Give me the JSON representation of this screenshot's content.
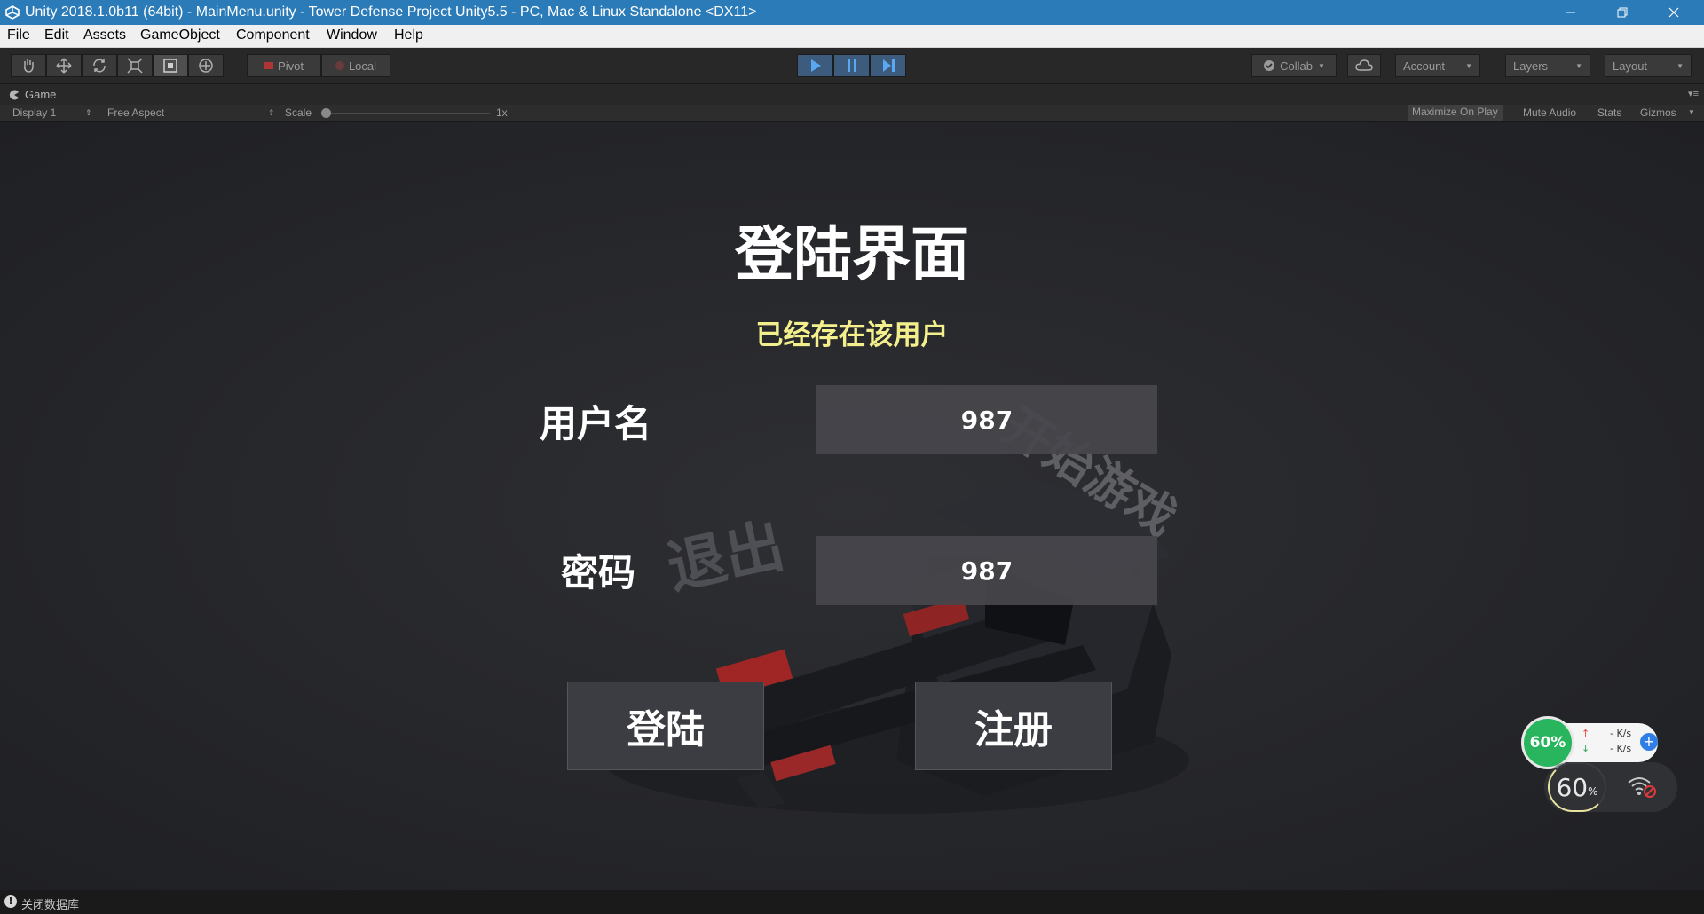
{
  "window": {
    "title": "Unity 2018.1.0b11 (64bit) - MainMenu.unity - Tower Defense Project Unity5.5 - PC, Mac & Linux Standalone <DX11>",
    "icons": [
      "unity-logo-icon",
      "minimize-icon",
      "restore-icon",
      "close-icon"
    ]
  },
  "menu": {
    "items": [
      "File",
      "Edit",
      "Assets",
      "GameObject",
      "Component",
      "Window",
      "Help"
    ]
  },
  "toolbar": {
    "tools": [
      "hand-tool-icon",
      "move-tool-icon",
      "rotate-tool-icon",
      "scale-tool-icon",
      "rect-tool-icon",
      "transform-tool-icon"
    ],
    "pivot_label": "Pivot",
    "local_label": "Local",
    "playback": [
      "play-icon",
      "pause-icon",
      "step-icon"
    ],
    "collab_label": "Collab",
    "account_label": "Account",
    "layers_label": "Layers",
    "layout_label": "Layout",
    "accent": "#3d5c7d"
  },
  "game_view": {
    "tab_label": "Game",
    "display": "Display 1",
    "aspect": "Free Aspect",
    "scale_label": "Scale",
    "scale_value": "1x",
    "maximize_label": "Maximize On Play",
    "mute_label": "Mute Audio",
    "stats_label": "Stats",
    "gizmos_label": "Gizmos"
  },
  "scene": {
    "heading": "登陆界面",
    "message": "已经存在该用户",
    "message_color": "#f3ef8c",
    "username_label": "用户名",
    "username_value": "987",
    "password_label": "密码",
    "password_value": "987",
    "login_button": "登陆",
    "register_button": "注册",
    "start_watermark": "开始游戏",
    "exit_watermark": "退出"
  },
  "net_widget": {
    "memory_percent": "60%",
    "up_speed": "- K/s",
    "down_speed": "- K/s",
    "cpu_value": "60",
    "cpu_unit": "%"
  },
  "status": {
    "message": "关闭数据库"
  }
}
